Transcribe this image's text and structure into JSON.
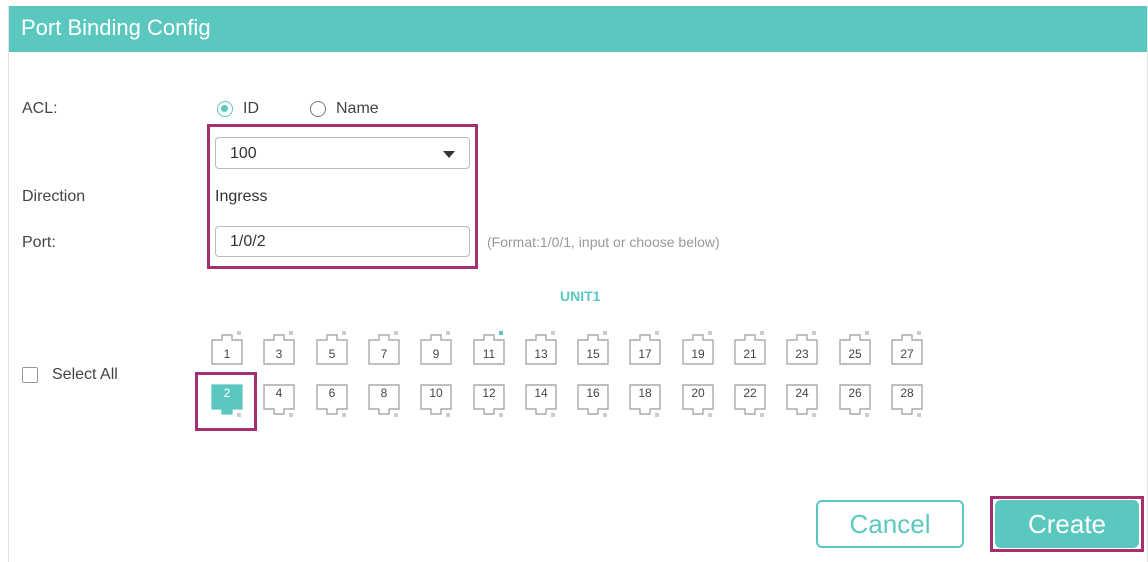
{
  "dialog": {
    "title": "Port Binding Config"
  },
  "acl": {
    "label": "ACL:",
    "options": [
      {
        "label": "ID",
        "selected": true
      },
      {
        "label": "Name",
        "selected": false
      }
    ],
    "selected_value": "100"
  },
  "direction": {
    "label": "Direction",
    "value": "Ingress"
  },
  "port": {
    "label": "Port:",
    "value": "1/0/2",
    "hint": "(Format:1/0/1, input or choose below)"
  },
  "unit": {
    "label": "UNIT1",
    "select_all_label": "Select All",
    "top_row": [
      "1",
      "3",
      "5",
      "7",
      "9",
      "11",
      "13",
      "15",
      "17",
      "19",
      "21",
      "23",
      "25",
      "27"
    ],
    "bottom_row": [
      "2",
      "4",
      "6",
      "8",
      "10",
      "12",
      "14",
      "16",
      "18",
      "20",
      "22",
      "24",
      "26",
      "28"
    ],
    "selected_port": "2",
    "port_with_led_on": "11"
  },
  "buttons": {
    "cancel": "Cancel",
    "create": "Create"
  },
  "colors": {
    "accent": "#5bc8c0",
    "highlight": "#a4306f"
  }
}
